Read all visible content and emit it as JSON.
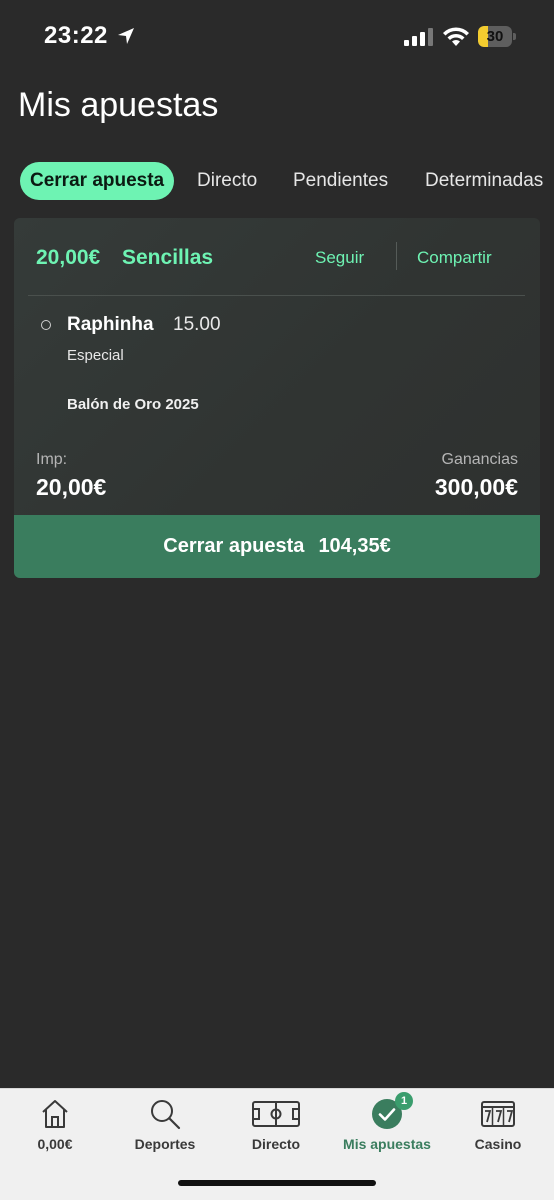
{
  "status_bar": {
    "time": "23:22",
    "battery": "30",
    "battery_level": 0.3
  },
  "page": {
    "title": "Mis apuestas"
  },
  "tabs": [
    {
      "label": "Cerrar apuesta",
      "active": true
    },
    {
      "label": "Directo",
      "active": false
    },
    {
      "label": "Pendientes",
      "active": false
    },
    {
      "label": "Determinadas",
      "active": false
    }
  ],
  "bet": {
    "stake_header": "20,00€",
    "type": "Sencillas",
    "follow_label": "Seguir",
    "share_label": "Compartir",
    "selection": {
      "name": "Raphinha",
      "odds": "15.00",
      "market": "Especial",
      "event": "Balón de Oro 2025"
    },
    "stake_label": "Imp:",
    "stake_value": "20,00€",
    "winnings_label": "Ganancias",
    "winnings_value": "300,00€",
    "cashout_label": "Cerrar apuesta",
    "cashout_amount": "104,35€"
  },
  "bottom_nav": [
    {
      "label": "0,00€",
      "icon": "home-icon",
      "active": false
    },
    {
      "label": "Deportes",
      "icon": "search-icon",
      "active": false
    },
    {
      "label": "Directo",
      "icon": "pitch-icon",
      "active": false
    },
    {
      "label": "Mis apuestas",
      "icon": "check-circle-icon",
      "active": true,
      "badge": "1"
    },
    {
      "label": "Casino",
      "icon": "slot-machine-icon",
      "active": false
    }
  ],
  "colors": {
    "accent": "#6ef3b3",
    "button_green": "#3a7d5e",
    "background": "#2a2a2a"
  }
}
